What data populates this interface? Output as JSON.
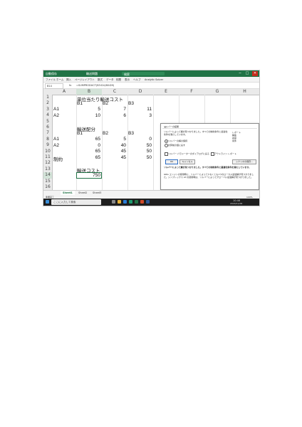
{
  "titlebar": {
    "autosave": "自動保存",
    "filename": "輸送問題",
    "search": "検索",
    "user": "",
    "btn_min": "─",
    "btn_max": "□",
    "btn_close": "✕"
  },
  "ribbon_tabs": [
    "ファイル",
    "ホーム",
    "挿入",
    "ページレイアウト",
    "数式",
    "データ",
    "校閲",
    "表示",
    "ヘルプ",
    "Analytic Solver"
  ],
  "formula_bar": {
    "cell_ref": "B14",
    "fx": "fx",
    "formula": "=SUMPRODUCT(B3:D4,B8:D9)"
  },
  "columns": [
    "A",
    "B",
    "C",
    "D",
    "E",
    "F",
    "G",
    "H"
  ],
  "rows": [
    "1",
    "2",
    "3",
    "4",
    "5",
    "6",
    "7",
    "8",
    "9",
    "10",
    "11",
    "12",
    "13",
    "14",
    "15",
    "16"
  ],
  "cells": {
    "B1": "単位当たり輸送コスト",
    "B2": "B1",
    "C2": "B2",
    "D2": "B3",
    "A3": "A1",
    "B3": "5",
    "C3": "7",
    "D3": "11",
    "A4": "A2",
    "B4": "10",
    "C4": "6",
    "D4": "3",
    "B6": "輸送配分",
    "B7": "B1",
    "C7": "B2",
    "D7": "B3",
    "A8": "A1",
    "B8": "65",
    "C8": "5",
    "D8": "0",
    "A9": "A2",
    "B9": "0",
    "C9": "40",
    "D9": "50",
    "B10": "65",
    "C10": "45",
    "D10": "50",
    "A11": "制約",
    "B11": "65",
    "C11": "45",
    "D11": "50",
    "B13": "輸送コスト",
    "B14": "750"
  },
  "dialog": {
    "title": "ソルバーの結果",
    "close": "✕",
    "message": "ソルバーによって解が見つかりました。すべての制約条件と最適化条件を満たしています。",
    "report_label": "レポート",
    "reports": [
      "解答",
      "感度",
      "条件"
    ],
    "radio_keep": "ソルバーの解の保持",
    "radio_restore": "計算前の値に戻す",
    "check_return": "ソルバー パラメーターのダイアログに戻る",
    "check_outline": "アウトライン レポート",
    "ok": "OK",
    "cancel": "キャンセル",
    "save_scenario": "シナリオの保存...",
    "footer_bold": "ソルバーによって解が見つかりました。すべての制約条件と最適化条件を満たしています。",
    "footer_note": "GRG エンジンの使用時に、ソルバーによって少なくとも1つのローカル最適解が見つかりました。シンプレックス LP の使用時は、ソルバーによってグローバル最適解が見つかりました。"
  },
  "sheet_tabs": [
    "Sheet1",
    "Sheet2",
    "Sheet3"
  ],
  "status": {
    "left": "準備完了",
    "zoom": "100%"
  },
  "taskbar": {
    "search_placeholder": "ここに入力して検索",
    "time": "10:46",
    "date": "2020/11/06"
  }
}
